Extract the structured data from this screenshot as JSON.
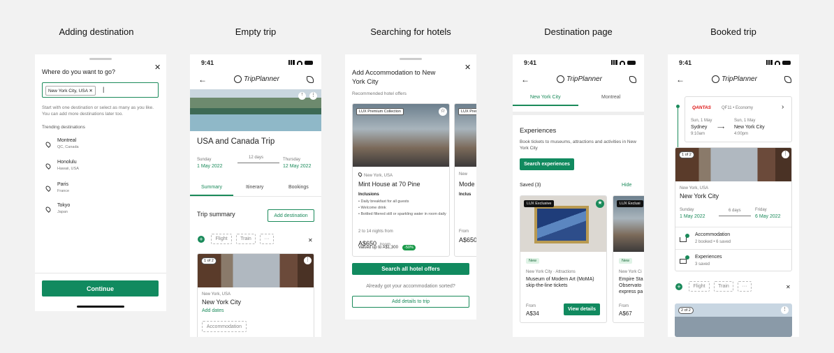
{
  "titles": [
    "Adding destination",
    "Empty trip",
    "Searching for hotels",
    "Destination page",
    "Booked trip"
  ],
  "time": "9:41",
  "logo": "TripPlanner",
  "s1": {
    "question": "Where do you want to go?",
    "chip": "New York City, USA",
    "helper": "Start with one destination or select as many as you like. You can add more destinations later too.",
    "trending_label": "Trending destinations",
    "destinations": [
      {
        "city": "Montreal",
        "region": "QC, Canada"
      },
      {
        "city": "Honolulu",
        "region": "Hawaii, USA"
      },
      {
        "city": "Paris",
        "region": "France"
      },
      {
        "city": "Tokyo",
        "region": "Japan"
      }
    ],
    "continue": "Continue"
  },
  "s2": {
    "trip_title": "USA and Canada Trip",
    "start_day": "Sunday",
    "start_date": "1 May 2022",
    "days": "12 days",
    "end_day": "Thursday",
    "end_date": "12 May 2022",
    "tabs": [
      "Summary",
      "Itinerary",
      "Bookings"
    ],
    "summary_label": "Trip summary",
    "add_dest": "Add destination",
    "transport": [
      "Flight",
      "Train",
      "···"
    ],
    "counter": "1 of 2",
    "loc": "New York, USA",
    "city": "New York City",
    "add_dates": "Add dates",
    "accom": "Accommodation"
  },
  "s3": {
    "title": "Add Accommodation to New York City",
    "subtitle": "Recommended hotel offers",
    "badge": "LUX Premium Collection",
    "badge2": "LUX Prem",
    "loc": "New York, USA",
    "loc2": "New",
    "hotel": "Mint House at 70 Pine",
    "hotel2": "Mode",
    "incl_label": "Inclusions",
    "incl2": "Inclus",
    "inclusions": [
      "Daily breakfast for all guests",
      "Welcome drink",
      "Bottled filtered still or sparkling water in room daily"
    ],
    "nights": "2 to 14 nights from",
    "from2": "From",
    "price": "A$650",
    "price2": "A$650",
    "per": "/room",
    "valued": "Valued up to A$1,300",
    "save": "-50%",
    "search_all": "Search all hotel offers",
    "sorted": "Already got your accommodation sorted?",
    "add_details": "Add details to trip"
  },
  "s4": {
    "tabs": [
      "New York City",
      "Montreal"
    ],
    "exp_title": "Experiences",
    "exp_desc": "Book tickets to museums, attractions and activities in New York City",
    "search_exp": "Search experiences",
    "saved": "Saved (3)",
    "hide": "Hide",
    "badge": "LUX Exclusive",
    "badge2": "LUX Exclusi",
    "new": "New",
    "loc": "New York City · Attractions",
    "loc2": "New York Ci",
    "title": "Museum of Modern Art (MoMA) skip-the-line tickets",
    "title2": "Empire Sta Observato express pa",
    "from": "From",
    "price": "A$34",
    "price2": "A$67",
    "view": "View details"
  },
  "s5": {
    "airline": "QANTAS",
    "flight": "QF11 • Economy",
    "from_date": "Sun, 1 May",
    "from_city": "Sydney",
    "from_time": "9:10am",
    "to_date": "Sun, 1 May",
    "to_city": "New York City",
    "to_time": "4:00pm",
    "counter": "1 of 2",
    "loc": "New York, USA",
    "city": "New York City",
    "start_day": "Sunday",
    "start_date": "1 May 2022",
    "days": "6 days",
    "end_day": "Friday",
    "end_date": "6 May 2022",
    "acc": "Accommodation",
    "acc_sub": "2 booked • 6 saved",
    "exp": "Experiences",
    "exp_sub": "3 saved",
    "transport": [
      "Flight",
      "Train",
      "···"
    ],
    "counter2": "2 of 2"
  }
}
